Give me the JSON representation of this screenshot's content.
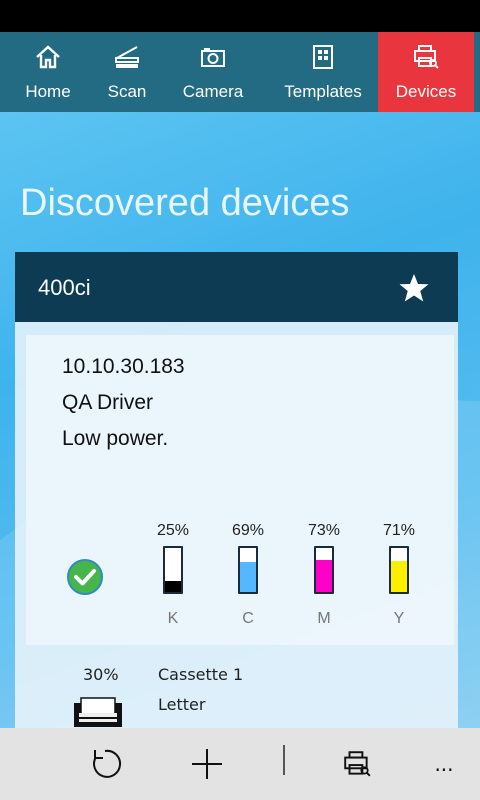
{
  "nav": {
    "items": [
      {
        "label": "Home",
        "icon": "home-icon"
      },
      {
        "label": "Scan",
        "icon": "scan-icon"
      },
      {
        "label": "Camera",
        "icon": "camera-icon"
      },
      {
        "label": "Templates",
        "icon": "templates-icon"
      },
      {
        "label": "Devices",
        "icon": "devices-icon",
        "active": true
      }
    ],
    "active_color": "#e8353e",
    "bar_color": "#236a83"
  },
  "page": {
    "title": "Discovered devices"
  },
  "device": {
    "name": "400ci",
    "favorite": true,
    "ip": "10.10.30.183",
    "driver": "QA Driver",
    "status": "Low power.",
    "status_icon": "checkmark-circle-icon",
    "inks": [
      {
        "letter": "K",
        "percent_label": "25%",
        "level": 0.25,
        "color": "#000000"
      },
      {
        "letter": "C",
        "percent_label": "69%",
        "level": 0.69,
        "color": "#55b8ff"
      },
      {
        "letter": "M",
        "percent_label": "73%",
        "level": 0.73,
        "color": "#ff00c8"
      },
      {
        "letter": "Y",
        "percent_label": "71%",
        "level": 0.71,
        "color": "#ffee00"
      }
    ],
    "tray": {
      "percent_label": "30%",
      "name": "Cassette 1",
      "paper_size": "Letter"
    }
  },
  "app_bar": {
    "buttons": [
      "refresh-icon",
      "add-icon",
      "printer-search-icon",
      "more-icon"
    ],
    "more_label": "..."
  }
}
